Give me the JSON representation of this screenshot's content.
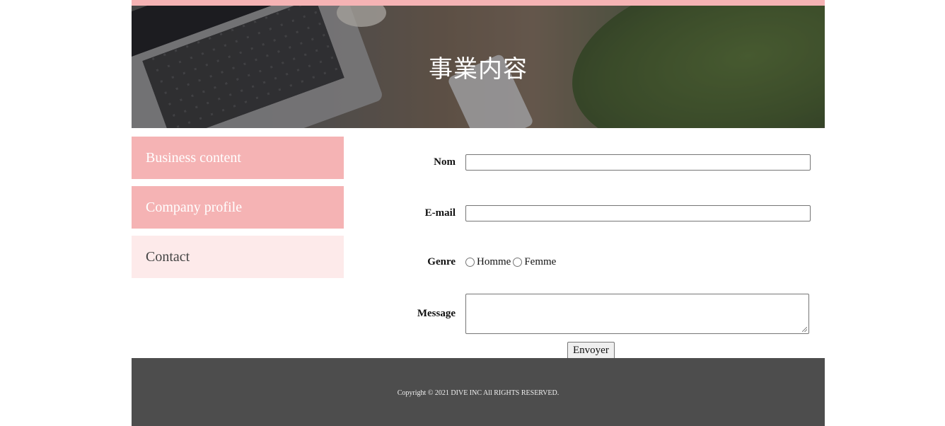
{
  "header": {
    "title": "事業内容"
  },
  "sidebar": {
    "items": [
      {
        "label": "Business content"
      },
      {
        "label": "Company profile"
      },
      {
        "label": "Contact"
      }
    ]
  },
  "form": {
    "name_label": "Nom",
    "name_value": "",
    "email_label": "E-mail",
    "email_value": "",
    "gender_label": "Genre",
    "gender_options": [
      "Homme",
      "Femme"
    ],
    "message_label": "Message",
    "message_value": "",
    "submit_label": "Envoyer"
  },
  "footer": {
    "copyright": "Copyright © 2021 DIVE INC All RIGHTS RESERVED."
  },
  "colors": {
    "accent": "#f5b3b4",
    "accent_light": "#fdeaea",
    "footer_bg": "#4d4d4d"
  },
  "icons": [
    "radio-unchecked-icon"
  ]
}
